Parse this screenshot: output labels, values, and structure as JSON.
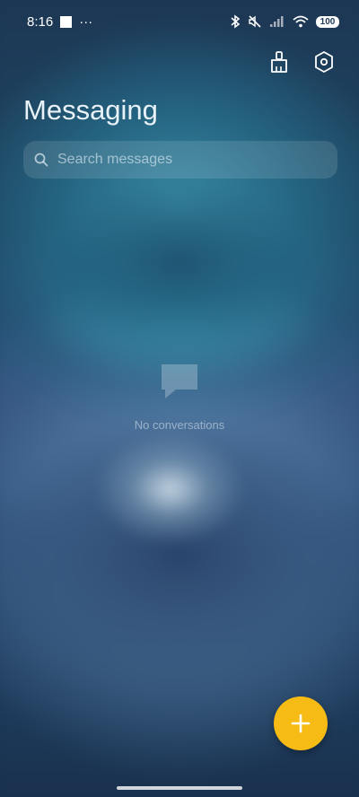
{
  "status_bar": {
    "time": "8:16",
    "overflow": "···",
    "battery": "100",
    "icons": [
      "notification-square-icon",
      "bluetooth-icon",
      "muted-vibrate-icon",
      "signal-icon",
      "wifi-icon",
      "battery-icon"
    ]
  },
  "header": {
    "title": "Messaging",
    "actions": [
      {
        "name": "clean-up-button",
        "icon": "brush-icon"
      },
      {
        "name": "settings-button",
        "icon": "gear-icon"
      }
    ]
  },
  "search": {
    "placeholder": "Search messages",
    "value": ""
  },
  "empty_state": {
    "icon": "message-bubble-icon",
    "text": "No conversations"
  },
  "fab": {
    "icon": "plus-icon",
    "color": "#f6bb14"
  }
}
